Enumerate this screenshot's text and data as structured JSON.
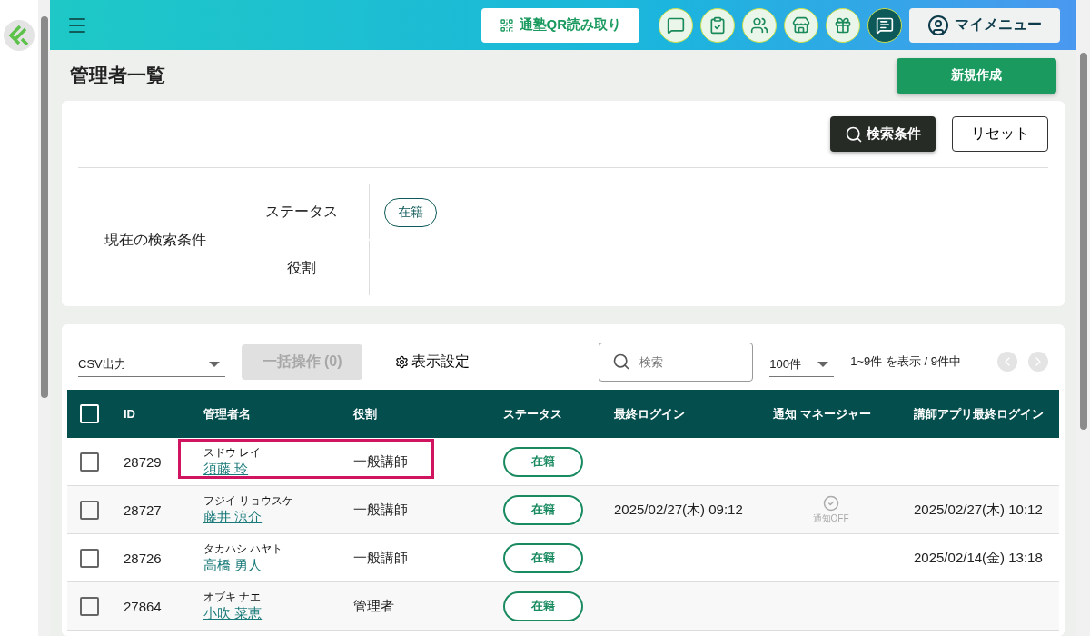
{
  "header": {
    "qr_button": "通塾QR読み取り",
    "my_menu": "マイメニュー"
  },
  "title": "管理者一覧",
  "new_button": "新規作成",
  "filter": {
    "search_button": "検索条件",
    "reset_button": "リセット",
    "current_label": "現在の検索条件",
    "conditions": [
      {
        "label": "ステータス",
        "values": [
          "在籍"
        ]
      },
      {
        "label": "役割"
      }
    ]
  },
  "list": {
    "csv_select": "CSV出力",
    "bulk_button": {
      "label": "一括操作 (0)",
      "disabled": true
    },
    "display_settings": "表示設定",
    "search_placeholder": "検索",
    "per_page": "100件",
    "range_text": "1~9件 を表示 / 9件中",
    "pager": {
      "prev_disabled": true,
      "next_disabled": true
    },
    "select_all": {
      "checked": false
    },
    "columns": [
      "ID",
      "管理者名",
      "役割",
      "ステータス",
      "最終ログイン",
      "通知 マネージャー",
      "講師アプリ最終ログイン"
    ],
    "rows": [
      {
        "checked": false,
        "highlighted": true,
        "id": "28729",
        "kana": "スドウ レイ",
        "name": "須藤 玲",
        "role": "一般講師",
        "status": "在籍"
      },
      {
        "checked": false,
        "highlighted": false,
        "id": "28727",
        "kana": "フジイ リョウスケ",
        "name": "藤井 涼介",
        "role": "一般講師",
        "status": "在籍",
        "last_login": "2025/02/27(木) 09:12",
        "notify": "通知OFF",
        "app_login": "2025/02/27(木) 10:12"
      },
      {
        "checked": false,
        "highlighted": false,
        "id": "28726",
        "kana": "タカハシ ハヤト",
        "name": "高橋 勇人",
        "role": "一般講師",
        "status": "在籍",
        "app_login": "2025/02/14(金) 13:18"
      },
      {
        "checked": false,
        "highlighted": false,
        "id": "27864",
        "kana": "オブキ ナエ",
        "name": "小吹 菜恵",
        "role": "管理者",
        "status": "在籍"
      }
    ]
  }
}
